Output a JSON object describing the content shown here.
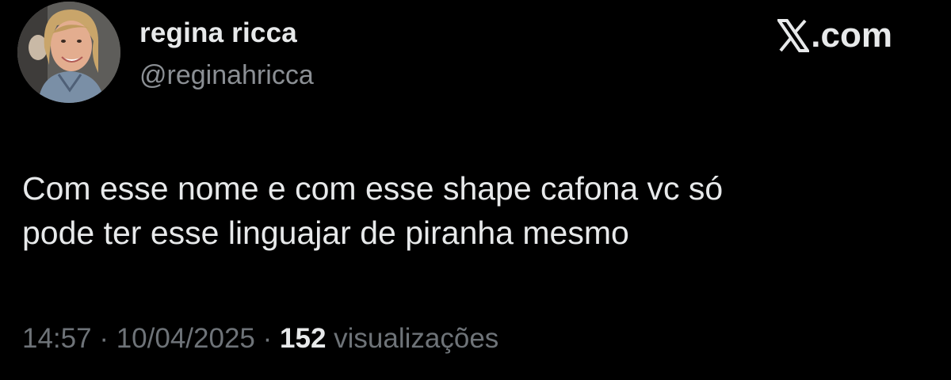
{
  "author": {
    "display_name": "regina ricca",
    "handle": "@reginahricca"
  },
  "brand": {
    "icon": "x-logo-icon",
    "suffix": ".com"
  },
  "tweet": {
    "text_lines": [
      "Com esse nome e com esse shape cafona vc só",
      "pode ter esse linguajar de piranha mesmo"
    ]
  },
  "meta": {
    "time": "14:57",
    "separator": "·",
    "date": "10/04/2025",
    "views_count": "152",
    "views_label": "visualizações"
  },
  "colors": {
    "background": "#000000",
    "primary_text": "#e7e9ea",
    "secondary_text": "#6e7378"
  }
}
